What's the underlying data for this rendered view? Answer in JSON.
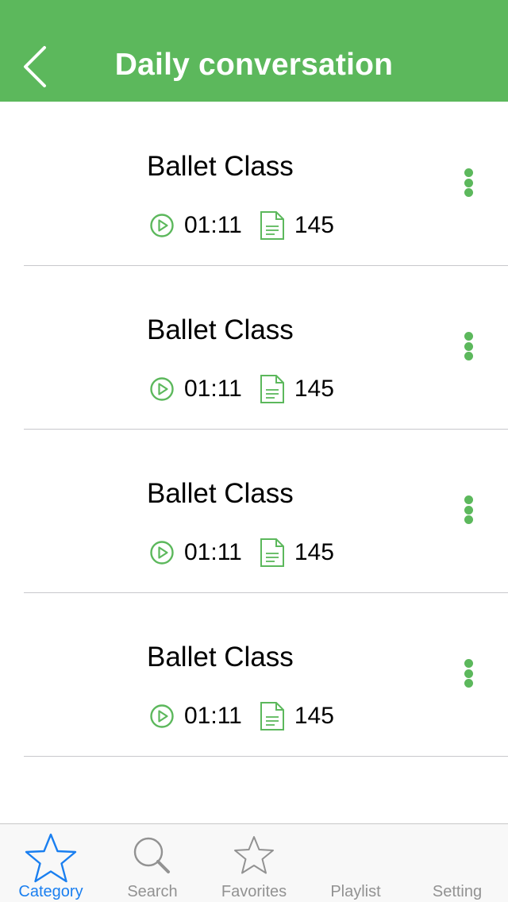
{
  "colors": {
    "accent": "#5cb85c",
    "tab_active": "#1a7ff0",
    "tab_inactive": "#929292"
  },
  "navbar": {
    "title": "Daily conversation",
    "back_icon": "chevron-left-icon"
  },
  "items": [
    {
      "title": "Ballet Class",
      "duration": "01:11",
      "count": "145"
    },
    {
      "title": "Ballet Class",
      "duration": "01:11",
      "count": "145"
    },
    {
      "title": "Ballet Class",
      "duration": "01:11",
      "count": "145"
    },
    {
      "title": "Ballet Class",
      "duration": "01:11",
      "count": "145"
    }
  ],
  "tabbar": {
    "tabs": [
      {
        "label": "Category",
        "icon": "star-icon",
        "active": true
      },
      {
        "label": "Search",
        "icon": "magnifier-icon",
        "active": false
      },
      {
        "label": "Favorites",
        "icon": "star-outline-icon",
        "active": false
      },
      {
        "label": "Playlist",
        "icon": "playlist-icon",
        "active": false
      },
      {
        "label": "Setting",
        "icon": "gear-icon",
        "active": false
      }
    ]
  }
}
